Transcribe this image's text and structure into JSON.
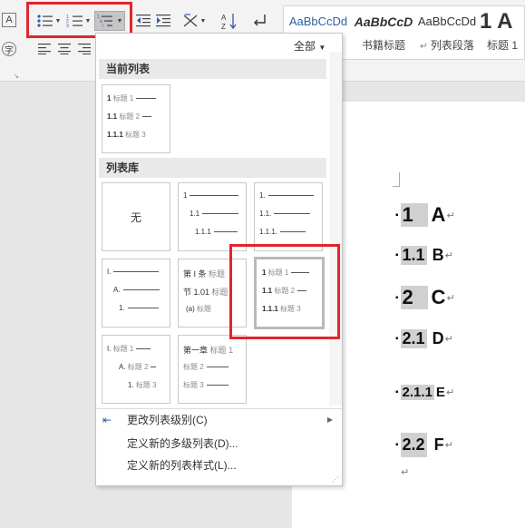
{
  "ribbon": {
    "gallery_items": [
      {
        "preview": "AaBbCcDd",
        "name": ""
      },
      {
        "preview": "AaBbCcD",
        "name": "书籍标题"
      },
      {
        "preview": "AaBbCcDd",
        "name": "列表段落"
      },
      {
        "preview": "1 A",
        "name": "标题 1"
      }
    ],
    "para_mark": "↵"
  },
  "panel": {
    "filter_label": "全部",
    "current_header": "当前列表",
    "library_header": "列表库",
    "none_label": "无",
    "heading_word": "标题",
    "menu": [
      {
        "label": "更改列表级别(C)"
      },
      {
        "label": "定义新的多级列表(D)..."
      },
      {
        "label": "定义新的列表样式(L)..."
      }
    ]
  },
  "document": {
    "lines": [
      {
        "num": "1",
        "text": "A"
      },
      {
        "num": "1.1",
        "text": "B"
      },
      {
        "num": "2",
        "text": "C"
      },
      {
        "num": "2.1",
        "text": "D"
      },
      {
        "num": "2.1.1",
        "text": "E"
      },
      {
        "num": "2.2",
        "text": "F"
      }
    ],
    "para_mark": "↵"
  },
  "thumbnails": {
    "current": [
      [
        "1",
        "标题",
        "1"
      ],
      [
        "1.1",
        "标题",
        "2"
      ],
      [
        "1.1.1",
        "标题",
        "3"
      ]
    ],
    "lib_1": [
      "1",
      "1.1",
      "1.1.1"
    ],
    "lib_2": [
      "1.",
      "1.1.",
      "1.1.1."
    ],
    "lib_3": [
      "I.",
      "A.",
      "1."
    ],
    "lib_4": [
      [
        "第 I 条",
        "标题"
      ],
      [
        "节 1.01",
        "标题"
      ],
      [
        "(a)",
        "标题"
      ]
    ],
    "lib_5": [
      [
        "1",
        "标题",
        "1"
      ],
      [
        "1.1",
        "标题",
        "2"
      ],
      [
        "1.1.1",
        "标题",
        "3"
      ]
    ],
    "lib_6": [
      [
        "I.",
        "标题",
        "1"
      ],
      [
        "A.",
        "标题",
        "2"
      ],
      [
        "1.",
        "标题",
        "3"
      ]
    ],
    "lib_7": [
      [
        "第一章",
        "标题",
        "1"
      ],
      [
        "",
        "标题",
        "2"
      ],
      [
        "",
        "标题",
        "3"
      ]
    ]
  }
}
